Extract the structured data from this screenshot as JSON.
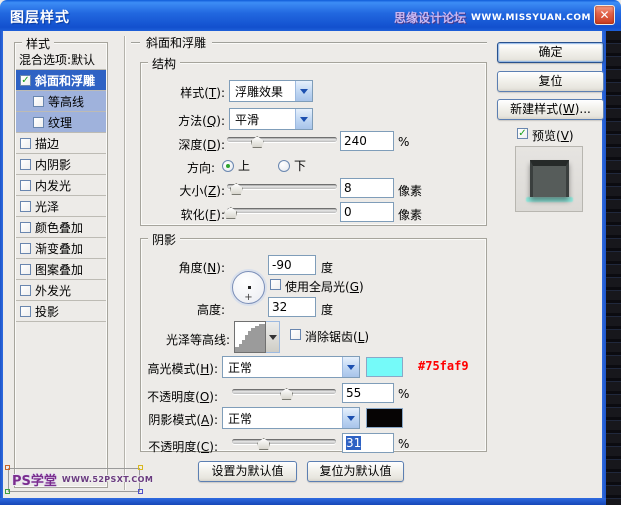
{
  "window": {
    "title": "图层样式",
    "close_glyph": "✕",
    "watermark_name": "思缘设计论坛",
    "watermark_url": "WWW.MISSYUAN.COM"
  },
  "sidebar": {
    "legend": "样式",
    "top_item": "混合选项:默认",
    "items": [
      {
        "label": "斜面和浮雕",
        "checked": true,
        "selected": true,
        "sub": false
      },
      {
        "label": "等高线",
        "checked": false,
        "selected": false,
        "sub": true
      },
      {
        "label": "纹理",
        "checked": false,
        "selected": false,
        "sub": true
      },
      {
        "label": "描边",
        "checked": false,
        "selected": false,
        "sub": false
      },
      {
        "label": "内阴影",
        "checked": false,
        "selected": false,
        "sub": false
      },
      {
        "label": "内发光",
        "checked": false,
        "selected": false,
        "sub": false
      },
      {
        "label": "光泽",
        "checked": false,
        "selected": false,
        "sub": false
      },
      {
        "label": "颜色叠加",
        "checked": false,
        "selected": false,
        "sub": false
      },
      {
        "label": "渐变叠加",
        "checked": false,
        "selected": false,
        "sub": false
      },
      {
        "label": "图案叠加",
        "checked": false,
        "selected": false,
        "sub": false
      },
      {
        "label": "外发光",
        "checked": false,
        "selected": false,
        "sub": false
      },
      {
        "label": "投影",
        "checked": false,
        "selected": false,
        "sub": false
      }
    ]
  },
  "panel": {
    "header": "斜面和浮雕",
    "structure": {
      "legend": "结构",
      "style_label": "样式(T):",
      "style_value": "浮雕效果",
      "technique_label": "方法(Q):",
      "technique_value": "平滑",
      "depth_label": "深度(D):",
      "depth_value": "240",
      "depth_unit": "%",
      "direction_label": "方向:",
      "direction_up": "上",
      "direction_down": "下",
      "size_label": "大小(Z):",
      "size_value": "8",
      "size_unit": "像素",
      "soften_label": "软化(F):",
      "soften_value": "0",
      "soften_unit": "像素"
    },
    "shading": {
      "legend": "阴影",
      "angle_label": "角度(N):",
      "angle_value": "-90",
      "angle_unit": "度",
      "global_light_label": "使用全局光(G)",
      "altitude_label": "高度:",
      "altitude_value": "32",
      "altitude_unit": "度",
      "gloss_contour_label": "光泽等高线:",
      "antialias_label": "消除锯齿(L)",
      "highlight_mode_label": "高光模式(H):",
      "highlight_mode_value": "正常",
      "highlight_color_note": "#75faf9",
      "highlight_opacity_label": "不透明度(O):",
      "highlight_opacity_value": "55",
      "highlight_opacity_unit": "%",
      "shadow_mode_label": "阴影模式(A):",
      "shadow_mode_value": "正常",
      "shadow_opacity_label": "不透明度(C):",
      "shadow_opacity_value": "31",
      "shadow_opacity_unit": "%"
    },
    "footer": {
      "set_default": "设置为默认值",
      "reset_default": "复位为默认值"
    }
  },
  "actions": {
    "ok": "确定",
    "reset": "复位",
    "new_style": "新建样式(W)...",
    "preview_label": "预览(V)"
  },
  "icons": {
    "check": "✓",
    "dial_cross": "+"
  },
  "colors": {
    "highlight_swatch": "#75faf9",
    "shadow_swatch": "#060404",
    "selection_blue": "#2E62C4",
    "note_red": "#FF0000"
  },
  "bottom_watermark": {
    "name": "PS学堂",
    "url": "WWW.52PSXT.COM"
  }
}
